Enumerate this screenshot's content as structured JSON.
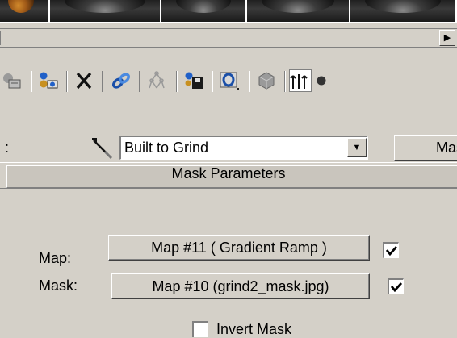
{
  "toolbar": {
    "icons": [
      "put-to-library-icon",
      "material-effects-channel-icon",
      "delete-icon",
      "link-chain-icon",
      "material-map-navigator-icon",
      "save-to-library-icon",
      "select-by-material-icon",
      "options-icon",
      "go-to-parent-icon",
      "go-forward-icon"
    ]
  },
  "name_row": {
    "colon": ":",
    "material_name": "Built to Grind",
    "type_button": "Mask"
  },
  "rollout": {
    "title": "Mask Parameters"
  },
  "params": {
    "map_label": "Map:",
    "map_button": "Map #11  ( Gradient Ramp )",
    "map_checked": true,
    "mask_label": "Mask:",
    "mask_button": "Map #10 (grind2_mask.jpg)",
    "mask_checked": true,
    "invert_label": "Invert Mask"
  },
  "colors": {
    "panel_bg": "#d4d0c8",
    "slot_dark": "#202020",
    "active_slot_orange": "#c27a28"
  }
}
